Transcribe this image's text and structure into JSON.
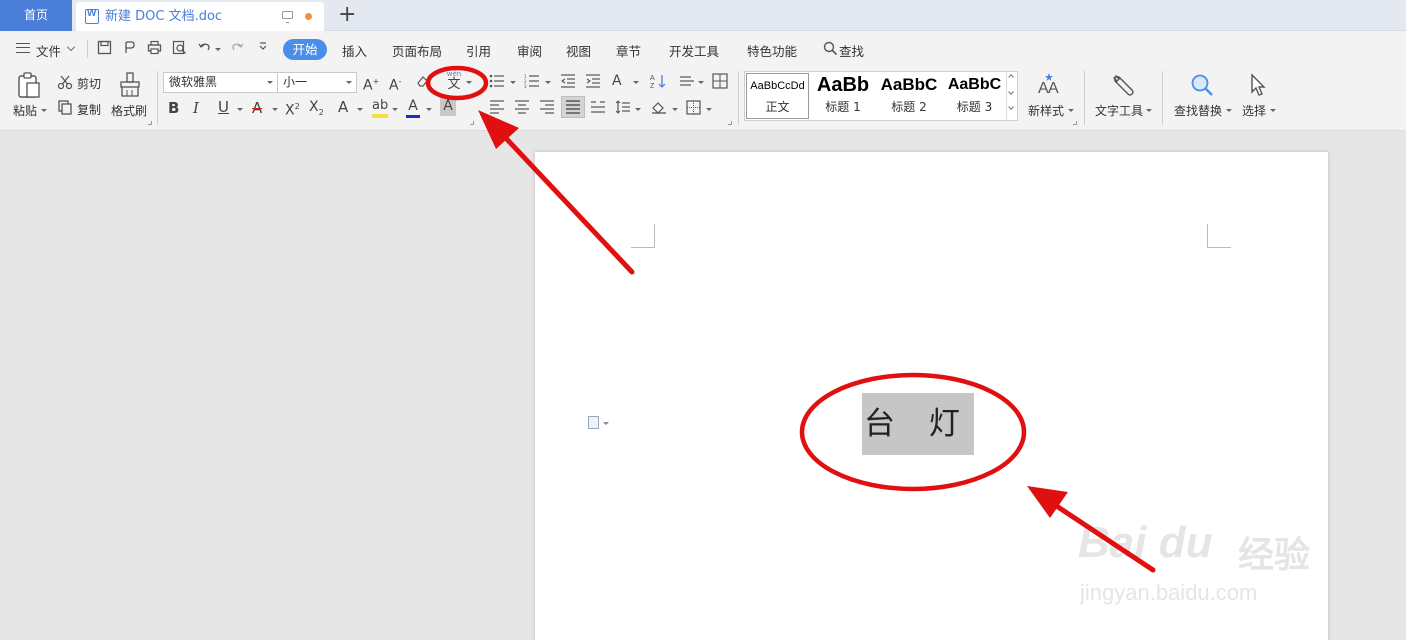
{
  "tabs": {
    "home": "首页",
    "document": "新建 DOC 文档.doc",
    "new_tab": "+"
  },
  "menu": {
    "file": "文件",
    "items": [
      "开始",
      "插入",
      "页面布局",
      "引用",
      "审阅",
      "视图",
      "章节",
      "开发工具",
      "特色功能"
    ],
    "search": "查找"
  },
  "ribbon": {
    "paste": "粘贴",
    "cut": "剪切",
    "copy": "复制",
    "format_painter": "格式刷",
    "font_name": "微软雅黑",
    "font_size": "小一",
    "phonetic_guide": "文",
    "phonetic_guide_top": "wén",
    "bold": "B",
    "italic": "I",
    "underline": "U",
    "styles": [
      {
        "preview": "AaBbCcDd",
        "name": "正文"
      },
      {
        "preview": "AaBb",
        "name": "标题 1"
      },
      {
        "preview": "AaBbC",
        "name": "标题 2"
      },
      {
        "preview": "AaBbC",
        "name": "标题 3"
      }
    ],
    "new_style": "新样式",
    "text_tools": "文字工具",
    "find_replace": "查找替换",
    "select": "选择"
  },
  "document": {
    "text": "台 灯"
  },
  "watermark": {
    "brand": "Bai du",
    "jingyan": "经验",
    "url": "jingyan.baidu.com"
  },
  "colors": {
    "accent": "#4a7ed8",
    "annotation": "#e01010",
    "selection": "#c6c6c6"
  }
}
